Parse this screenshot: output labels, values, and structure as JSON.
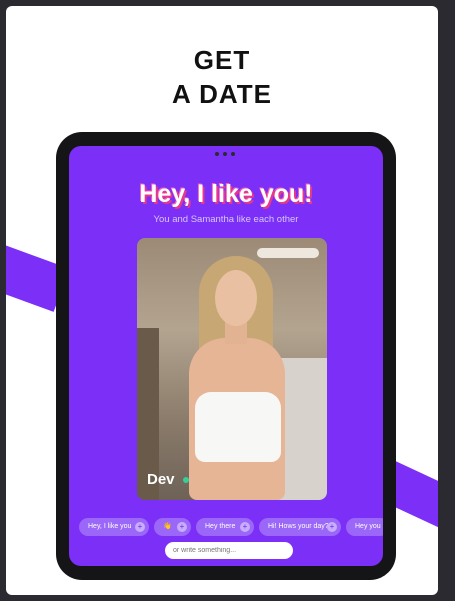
{
  "promo": {
    "headline_line1": "GET",
    "headline_line2": "A DATE"
  },
  "match_screen": {
    "title": "Hey, I like you!",
    "subtitle": "You and Samantha like each other",
    "profile_name": "Dev",
    "quick_replies": [
      "Hey, I like you",
      "👋",
      "Hey there",
      "Hi! Hows your day?",
      "Hey you"
    ],
    "message_placeholder": "or write something..."
  },
  "colors": {
    "brand_purple": "#7b2ff7",
    "title_shadow_pink": "#e6388a",
    "online_green": "#35d09a"
  },
  "icons": {
    "chip_add": "plus-circle-icon",
    "online": "online-dot-icon"
  }
}
